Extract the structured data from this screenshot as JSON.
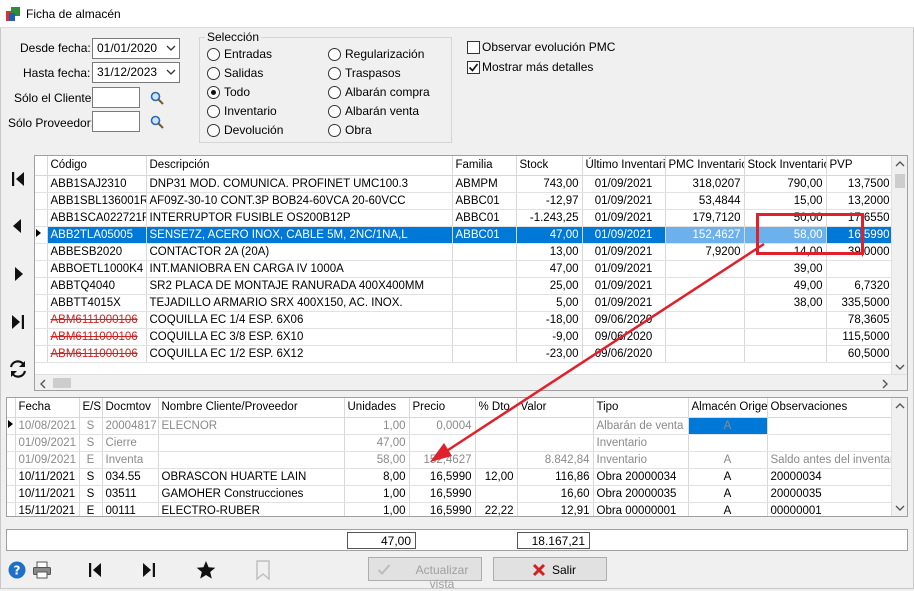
{
  "window": {
    "title": "Ficha de almacén"
  },
  "filters": {
    "desde_label": "Desde fecha:",
    "desde_value": "01/01/2020",
    "hasta_label": "Hasta fecha:",
    "hasta_value": "31/12/2023",
    "cliente_label": "Sólo el Cliente:",
    "cliente_value": "",
    "proveedor_label": "Sólo Proveedor:",
    "proveedor_value": ""
  },
  "seleccion": {
    "title": "Selección",
    "options": [
      "Entradas",
      "Salidas",
      "Todo",
      "Inventario",
      "Devolución",
      "Regularización",
      "Traspasos",
      "Albarán compra",
      "Albarán venta",
      "Obra"
    ],
    "selected": "Todo"
  },
  "options": {
    "pmc_label": "Observar evolución PMC",
    "pmc_checked": false,
    "detalles_label": "Mostrar más detalles",
    "detalles_checked": true
  },
  "articles": {
    "columns": [
      "Código",
      "Descripción",
      "Familia",
      "Stock",
      "Último Inventario",
      "PMC Inventario",
      "Stock Inventario",
      "PVP"
    ],
    "rows": [
      [
        "ABB1SAJ2310",
        "DNP31 MOD. COMUNICA. PROFINET UMC100.3",
        "ABMPM",
        "743,00",
        "01/09/2021",
        "318,0207",
        "790,00",
        "13,7500"
      ],
      [
        "ABB1SBL136001R",
        "AF09Z-30-10 CONT.3P BOB24-60VCA 20-60VCC",
        "ABBC01",
        "-12,97",
        "01/09/2021",
        "53,4844",
        "15,00",
        "13,2000"
      ],
      [
        "ABB1SCA022721R",
        "INTERRUPTOR FUSIBLE OS200B12P",
        "ABBC01",
        "-1.243,25",
        "01/09/2021",
        "179,7120",
        "50,00",
        "17,6550"
      ],
      [
        "ABB2TLA05005",
        "SENSE7Z, ACERO INOX, CABLE 5M, 2NC/1NA,L",
        "ABBC01",
        "47,00",
        "01/09/2021",
        "152,4627",
        "58,00",
        "16,5990"
      ],
      [
        "ABBESB2020",
        "CONTACTOR 2A (20A)",
        "",
        "13,00",
        "01/09/2021",
        "7,9200",
        "14,00",
        "39,0000"
      ],
      [
        "ABBOETL1000K4",
        "INT.MANIOBRA EN CARGA IV 1000A",
        "",
        "47,00",
        "01/09/2021",
        "",
        "39,00",
        ""
      ],
      [
        "ABBTQ4040",
        "SR2 PLACA DE MONTAJE RANURADA 400X400MM",
        "",
        "25,00",
        "01/09/2021",
        "",
        "49,00",
        "6,7320"
      ],
      [
        "ABBTT4015X",
        "TEJADILLO ARMARIO SRX 400X150, AC. INOX.",
        "",
        "5,00",
        "01/09/2021",
        "",
        "38,00",
        "335,5000"
      ],
      [
        "ABM6111000106",
        "COQUILLA EC 1/4 ESP. 6X06",
        "",
        "-18,00",
        "09/06/2020",
        "",
        "",
        "78,3605"
      ],
      [
        "ABM6111000106",
        "COQUILLA EC 3/8 ESP. 6X10",
        "",
        "-9,00",
        "09/06/2020",
        "",
        "",
        "115,5000"
      ],
      [
        "ABM6111000106",
        "COQUILLA EC 1/2 ESP. 6X12",
        "",
        "-23,00",
        "09/06/2020",
        "",
        "",
        "60,5000"
      ]
    ]
  },
  "movements": {
    "columns": [
      "Fecha",
      "E/S",
      "Docmtov",
      "Nombre Cliente/Proveedor",
      "Unidades",
      "Precio",
      "% Dto.",
      "Valor",
      "Tipo",
      "Almacén Origen",
      "Observaciones"
    ],
    "rows": [
      [
        "10/08/2021",
        "S",
        "20004817",
        "ELECNOR",
        "1,00",
        "0,0004",
        "",
        "",
        "Albarán de venta",
        "A",
        ""
      ],
      [
        "01/09/2021",
        "S",
        "Cierre",
        "",
        "47,00",
        "",
        "",
        "",
        "Inventario",
        "",
        ""
      ],
      [
        "01/09/2021",
        "E",
        "Inventa",
        "",
        "58,00",
        "152,4627",
        "",
        "8.842,84",
        "Inventario",
        "A",
        "Saldo antes del inventario"
      ],
      [
        "10/11/2021",
        "S",
        "034.55",
        "OBRASCON HUARTE LAIN",
        "8,00",
        "16,5990",
        "12,00",
        "116,86",
        "Obra 20000034",
        "A",
        "20000034"
      ],
      [
        "10/11/2021",
        "S",
        "03511",
        "GAMOHER Construcciones",
        "1,00",
        "16,5990",
        "",
        "16,60",
        "Obra 20000035",
        "A",
        "20000035"
      ],
      [
        "15/11/2021",
        "E",
        "00111",
        "ELECTRO-RUBER",
        "1,00",
        "16,5990",
        "22,22",
        "12,91",
        "Obra 00000001",
        "A",
        "00000001"
      ]
    ]
  },
  "totals": {
    "unidades": "47,00",
    "valor": "18.167,21"
  },
  "buttons": {
    "actualizar": "Actualizar vista",
    "salir": "Salir"
  },
  "colors": {
    "selection": "#0078d7",
    "annotation": "#e0202a",
    "strike": "#d02020"
  }
}
